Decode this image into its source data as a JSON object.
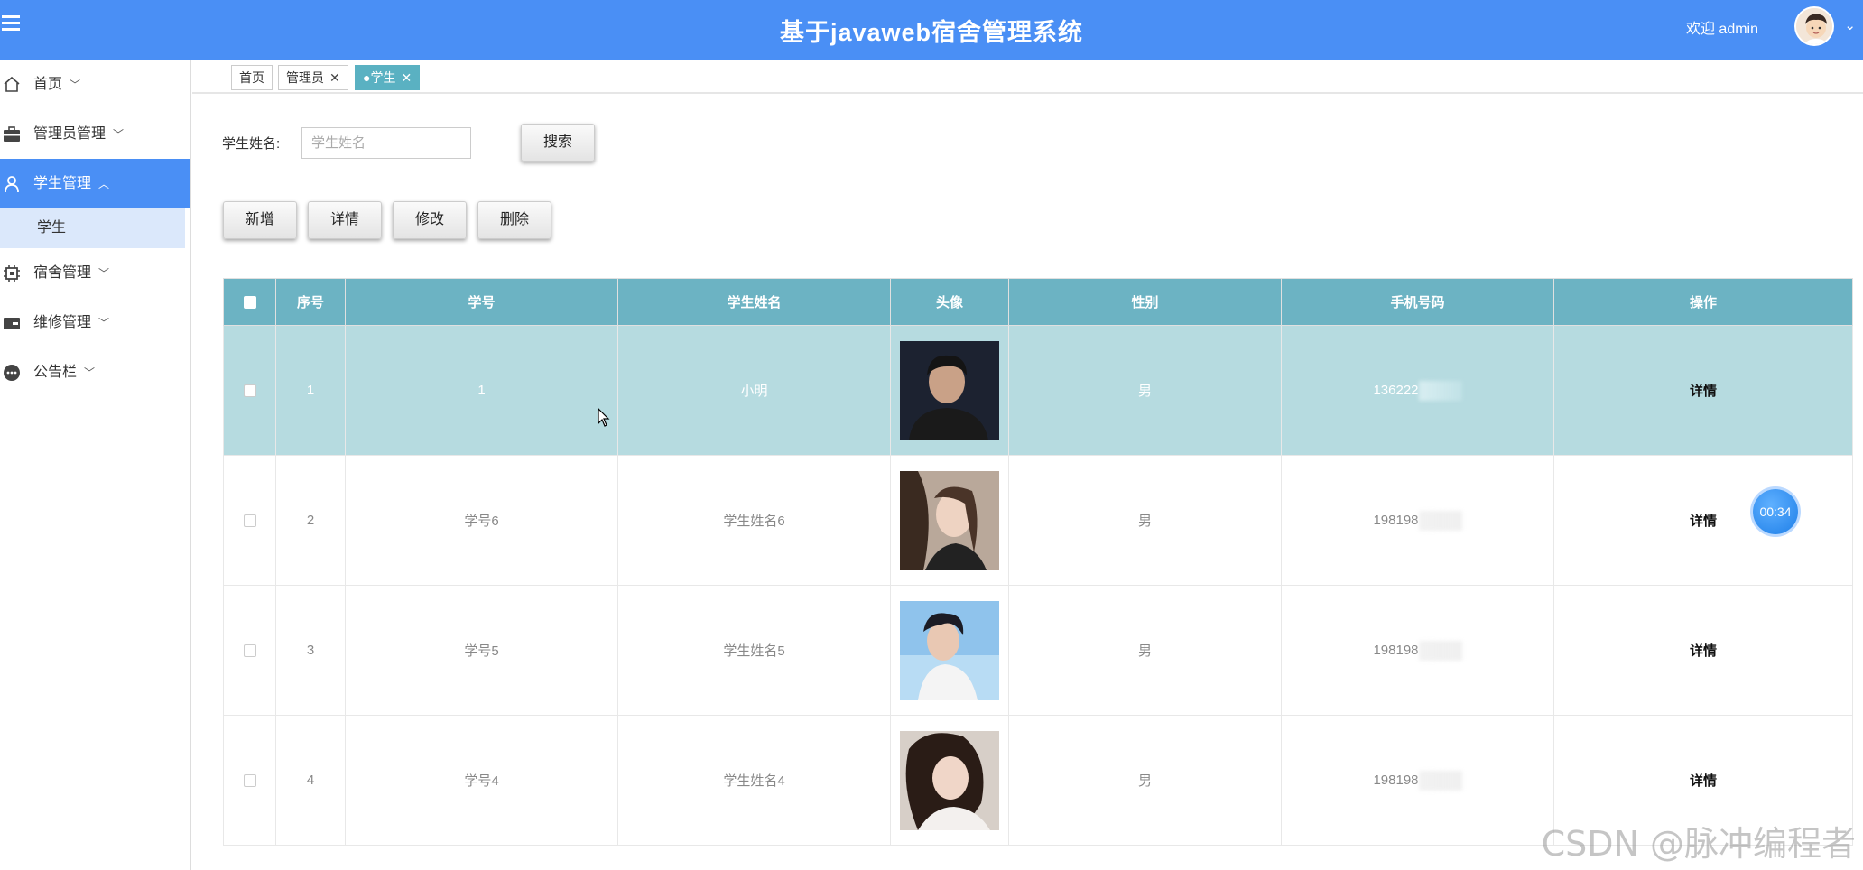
{
  "header": {
    "title": "基于javaweb宿舍管理系统",
    "welcome": "欢迎 admin"
  },
  "sidebar": {
    "items": [
      {
        "label": "首页",
        "icon": "home-icon"
      },
      {
        "label": "管理员管理",
        "icon": "briefcase-icon"
      },
      {
        "label": "学生管理",
        "icon": "user-icon",
        "active": true
      },
      {
        "label": "学生",
        "sub": true
      },
      {
        "label": "宿舍管理",
        "icon": "chip-icon"
      },
      {
        "label": "维修管理",
        "icon": "wallet-icon"
      },
      {
        "label": "公告栏",
        "icon": "chat-icon"
      }
    ]
  },
  "tabs": [
    {
      "label": "首页"
    },
    {
      "label": "管理员",
      "close": "✕"
    },
    {
      "label": "●学生",
      "close": "✕",
      "active": true
    }
  ],
  "search": {
    "label": "学生姓名:",
    "placeholder": "学生姓名",
    "button": "搜索"
  },
  "toolbar": {
    "add": "新增",
    "detail": "详情",
    "edit": "修改",
    "delete": "删除"
  },
  "table": {
    "headers": [
      "序号",
      "学号",
      "学生姓名",
      "头像",
      "性别",
      "手机号码",
      "操作"
    ],
    "rows": [
      {
        "index": "1",
        "student_no": "1",
        "name": "小明",
        "gender": "男",
        "phone": "136222",
        "action": "详情"
      },
      {
        "index": "2",
        "student_no": "学号6",
        "name": "学生姓名6",
        "gender": "男",
        "phone": "198198",
        "action": "详情"
      },
      {
        "index": "3",
        "student_no": "学号5",
        "name": "学生姓名5",
        "gender": "男",
        "phone": "198198",
        "action": "详情"
      },
      {
        "index": "4",
        "student_no": "学号4",
        "name": "学生姓名4",
        "gender": "男",
        "phone": "198198",
        "action": "详情"
      }
    ]
  },
  "timer": "00:34",
  "watermark": "CSDN @脉冲编程者",
  "colors": {
    "header_bg": "#4a8ff5",
    "table_header_bg": "#6cb3c3",
    "selected_row_bg": "#b6dbe0",
    "active_tab_bg": "#5ab1c2"
  }
}
